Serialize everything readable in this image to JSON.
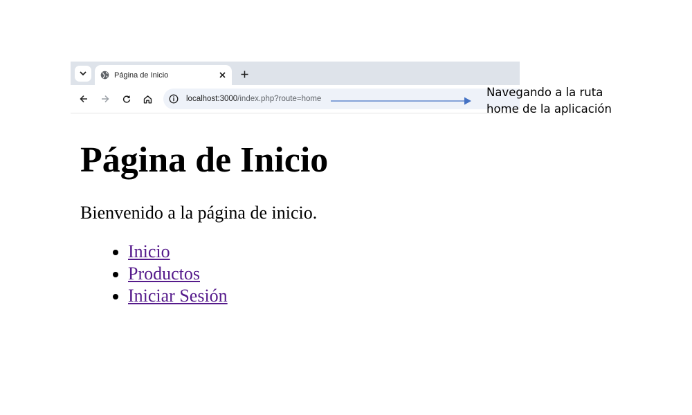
{
  "browser": {
    "tab": {
      "title": "Página de Inicio"
    },
    "new_tab_label": "+",
    "address_bar": {
      "host": "localhost:3000",
      "path": "/index.php?route=home"
    }
  },
  "annotation": {
    "line1": "Navegando a la ruta",
    "line2": "home de la aplicación",
    "arrow_color": "#4472c4"
  },
  "page": {
    "title": "Página de Inicio",
    "welcome": "Bienvenido a la página de inicio.",
    "nav_links": [
      {
        "label": "Inicio"
      },
      {
        "label": "Productos"
      },
      {
        "label": "Iniciar Sesión"
      }
    ],
    "link_color": "#551a8b"
  }
}
